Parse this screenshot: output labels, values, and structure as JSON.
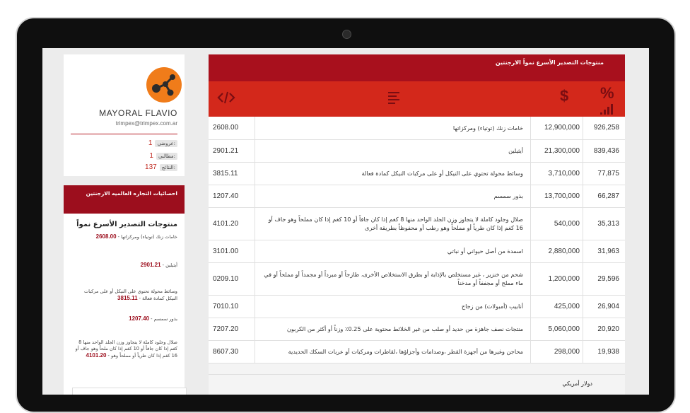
{
  "profile": {
    "name": "MAYORAL FLAVIO",
    "email": "trimpex@trimpex.com.ar",
    "stats": [
      {
        "label": ":عروضي",
        "value": "1"
      },
      {
        "label": ":مطالبي",
        "value": "1"
      },
      {
        "label": ":النتائج",
        "value": "137"
      }
    ]
  },
  "sidebar": {
    "header": "احصائيات التجاره العالميه الارجنتين",
    "title": "منتوجات التصدير الأسرع نمواً",
    "items": [
      {
        "desc": "خامات زنك (توتياء) ومركزاتها",
        "code": "2608.00"
      },
      {
        "desc": "أيثيلين",
        "code": "2901.21"
      },
      {
        "desc": "وسائط محولة تحتوي على النيكل أو على مركبات النيكل كمادة فعالة",
        "code": "3815.11"
      },
      {
        "desc": "بذور سمسم",
        "code": "1207.40"
      },
      {
        "desc": "صلال وجلود كاملة لا يتجاوز وزن الجلد الواحد منها 8 كغم إذا كان جافاً أو 10 كغم إذا كان ملحاً وهو جاف أو 16 كغم إذا كان طرياً أو مملحاً وهو",
        "code": "4101.20"
      }
    ]
  },
  "main": {
    "header": "منتوجات التصدير الأسرع نمواً الارجنتين",
    "icons": [
      "code-icon",
      "list-icon",
      "dollar-icon",
      "percent-chart-icon"
    ],
    "rows": [
      {
        "code": "2608.00",
        "desc": "خامات زنك (توتياء) ومركزاتها",
        "value": "12,900,000",
        "pct": "926,258"
      },
      {
        "code": "2901.21",
        "desc": "أيثيلين",
        "value": "21,300,000",
        "pct": "839,436"
      },
      {
        "code": "3815.11",
        "desc": "وسائط محولة تحتوي على النيكل أو على مركبات النيكل كمادة فعالة",
        "value": "3,710,000",
        "pct": "77,875"
      },
      {
        "code": "1207.40",
        "desc": "بذور سمسم",
        "value": "13,700,000",
        "pct": "66,287"
      },
      {
        "code": "4101.20",
        "desc": "صلال وجلود كاملة لا يتجاوز وزن الجلد الواحد منها 8 كغم إذا كان جافاً أو 10 كغم إذا كان مملحاً وهو جاف أو 16 كغم إذا كان طرياً أو مملحاً وهو رطب أو محفوظاً بطريقة أخرى",
        "value": "540,000",
        "pct": "35,313"
      },
      {
        "code": "3101.00",
        "desc": "اسمدة من أصل حيواني أو نباتي",
        "value": "2,880,000",
        "pct": "31,963"
      },
      {
        "code": "0209.10",
        "desc": "شحم من خنزير ، غير مستخلص بالإذابة أو بطرق الاستخلاص الأخرى، طازجاً أو مبرداً أو مجمداً أو مملحاً أو في ماء مملح أو مجففاً أو مدخناً",
        "value": "1,200,000",
        "pct": "29,596"
      },
      {
        "code": "7010.10",
        "desc": "أنابيب (أمبولات) من زجاج",
        "value": "425,000",
        "pct": "26,904"
      },
      {
        "code": "7207.20",
        "desc": "منتجات نصف جاهزة من حديد أو صلب من غير الخلائط محتوية على 0.25٪ وزناً أو أكثر من الكربون",
        "value": "5,060,000",
        "pct": "20,920"
      },
      {
        "code": "8607.30",
        "desc": "محاجن وغيرها من أجهزة القطر ،وصدامات وأجزاؤها ،لقاطرات ومركبات أو عربات السكك الحديدية",
        "value": "298,000",
        "pct": "19,938"
      }
    ],
    "footer": "دولار أمريكي"
  },
  "colors": {
    "accent": "#d3281b",
    "dark_red": "#a8101d",
    "logo_orange": "#f07c1a"
  }
}
